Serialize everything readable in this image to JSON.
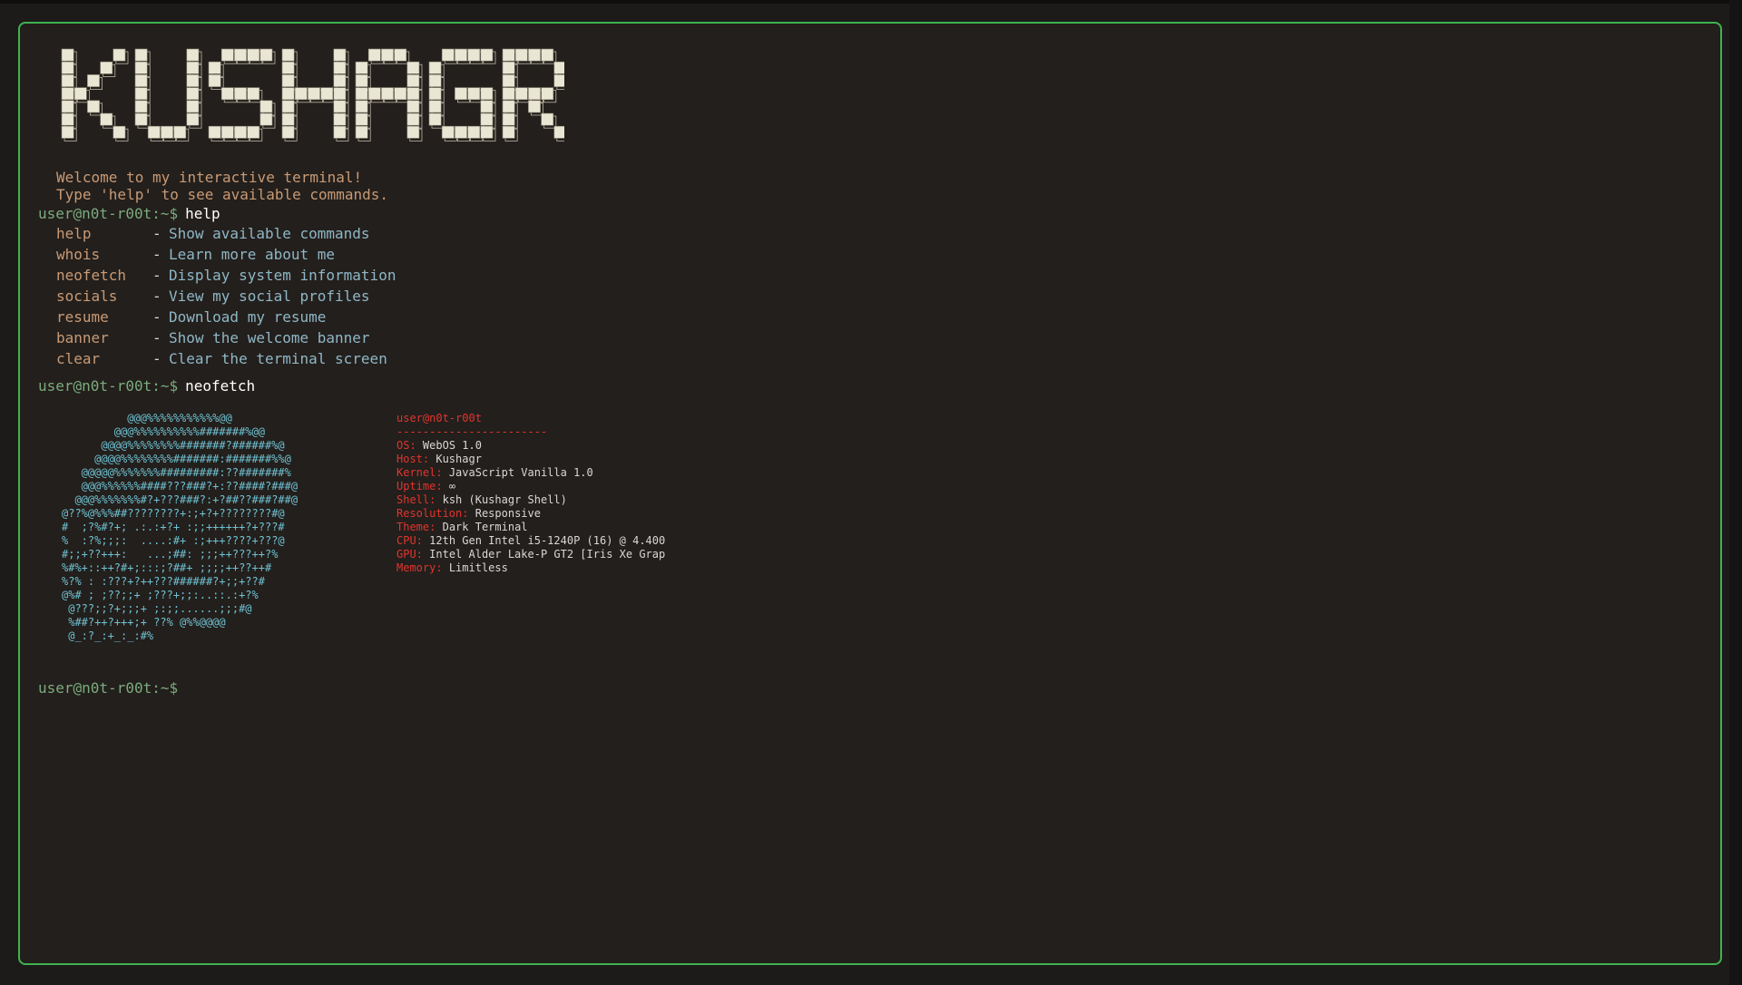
{
  "banner_text": "KUSHAGR",
  "welcome": {
    "line1": "Welcome to my interactive terminal!",
    "line2": "Type 'help' to see available commands."
  },
  "prompt": "user@n0t-r00t:~$",
  "commands_entered": [
    "help",
    "neofetch"
  ],
  "help": [
    {
      "cmd": "help",
      "desc": "Show available commands"
    },
    {
      "cmd": "whois",
      "desc": "Learn more about me"
    },
    {
      "cmd": "neofetch",
      "desc": "Display system information"
    },
    {
      "cmd": "socials",
      "desc": "View my social profiles"
    },
    {
      "cmd": "resume",
      "desc": "Download my resume"
    },
    {
      "cmd": "banner",
      "desc": "Show the welcome banner"
    },
    {
      "cmd": "clear",
      "desc": "Clear the terminal screen"
    }
  ],
  "help_dash": "-",
  "neofetch": {
    "ascii_art": "          @@@%%%%%%%%%%%@@\n        @@@%%%%%%%%%%#######%@@\n      @@@@%%%%%%%%#######?######%@\n     @@@@%%%%%%%%#######:#######%%@\n   @@@@@%%%%%%%#########:??#######%\n   @@@%%%%%%####???###?+:??####?###@\n  @@@%%%%%%%#?+???###?:+?##??###?##@\n@??%@%%%##????????+:;+?+????????#@\n#  ;?%#?+; .:.:+?+ :;;++++++?+???#\n%  :?%;;;:  ....:#+ :;+++????+???@\n#;;+??+++:   ...;##: ;;;++???++?%\n%#%+::++?#+;:::;?##+ ;;;;++??++#\n%?% : :???+?++???######?+;;+??#\n@%# ; ;??;;+ ;???+;;:..::.:+?%\n @???;;?+;;;+ ;:;;......;;;#@\n %##?++?+++;+ ??% @%%@@@@\n @_:?_:+_:_:#%",
    "title": "user@n0t-r00t",
    "separator": "-----------------------",
    "rows": [
      {
        "key": "OS:",
        "val": "WebOS 1.0"
      },
      {
        "key": "Host:",
        "val": "Kushagr"
      },
      {
        "key": "Kernel:",
        "val": "JavaScript Vanilla 1.0"
      },
      {
        "key": "Uptime:",
        "val": "∞"
      },
      {
        "key": "Shell:",
        "val": "ksh (Kushagr Shell)"
      },
      {
        "key": "Resolution:",
        "val": "Responsive"
      },
      {
        "key": "Theme:",
        "val": "Dark Terminal"
      },
      {
        "key": "CPU:",
        "val": "12th Gen Intel i5-1240P (16) @ 4.400"
      },
      {
        "key": "GPU:",
        "val": "Intel Alder Lake-P GT2 [Iris Xe Grap"
      },
      {
        "key": "Memory:",
        "val": "Limitless"
      }
    ]
  },
  "colors": {
    "border": "#3fb34f",
    "background": "#231f1c",
    "prompt": "#7bab7e",
    "accent": "#c89a75",
    "desc": "#8fb7c6",
    "ascii": "#6fc2d3",
    "info_key": "#e0352f"
  }
}
